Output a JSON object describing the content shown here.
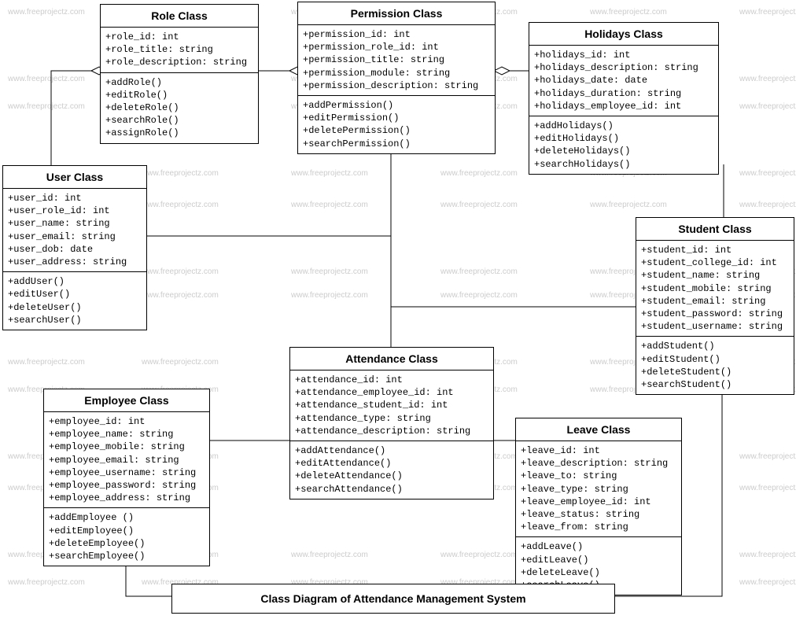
{
  "diagram_title": "Class Diagram of Attendance Management System",
  "watermark_text": "www.freeprojectz.com",
  "classes": {
    "role": {
      "title": "Role Class",
      "attrs": [
        "+role_id: int",
        "+role_title: string",
        "+role_description: string"
      ],
      "methods": [
        "+addRole()",
        "+editRole()",
        "+deleteRole()",
        "+searchRole()",
        "+assignRole()"
      ]
    },
    "permission": {
      "title": "Permission Class",
      "attrs": [
        "+permission_id: int",
        "+permission_role_id: int",
        "+permission_title: string",
        "+permission_module: string",
        "+permission_description: string"
      ],
      "methods": [
        "+addPermission()",
        "+editPermission()",
        "+deletePermission()",
        "+searchPermission()"
      ]
    },
    "holidays": {
      "title": "Holidays Class",
      "attrs": [
        "+holidays_id: int",
        "+holidays_description: string",
        "+holidays_date: date",
        "+holidays_duration: string",
        "+holidays_employee_id: int"
      ],
      "methods": [
        "+addHolidays()",
        "+editHolidays()",
        "+deleteHolidays()",
        "+searchHolidays()"
      ]
    },
    "user": {
      "title": "User Class",
      "attrs": [
        "+user_id: int",
        "+user_role_id: int",
        "+user_name: string",
        "+user_email: string",
        "+user_dob: date",
        "+user_address: string"
      ],
      "methods": [
        "+addUser()",
        "+editUser()",
        "+deleteUser()",
        "+searchUser()"
      ]
    },
    "student": {
      "title": "Student Class",
      "attrs": [
        "+student_id: int",
        "+student_college_id: int",
        "+student_name: string",
        "+student_mobile: string",
        "+student_email: string",
        "+student_password: string",
        "+student_username: string"
      ],
      "methods": [
        "+addStudent()",
        "+editStudent()",
        "+deleteStudent()",
        "+searchStudent()"
      ]
    },
    "attendance": {
      "title": "Attendance Class",
      "attrs": [
        "+attendance_id: int",
        "+attendance_employee_id: int",
        "+attendance_student_id: int",
        "+attendance_type: string",
        "+attendance_description: string"
      ],
      "methods": [
        "+addAttendance()",
        "+editAttendance()",
        "+deleteAttendance()",
        "+searchAttendance()"
      ]
    },
    "employee": {
      "title": "Employee Class",
      "attrs": [
        "+employee_id: int",
        "+employee_name: string",
        "+employee_mobile: string",
        "+employee_email: string",
        "+employee_username: string",
        "+employee_password: string",
        "+employee_address: string"
      ],
      "methods": [
        "+addEmployee ()",
        "+editEmployee()",
        "+deleteEmployee()",
        "+searchEmployee()"
      ]
    },
    "leave": {
      "title": "Leave Class",
      "attrs": [
        "+leave_id: int",
        "+leave_description: string",
        "+leave_to: string",
        "+leave_type: string",
        "+leave_employee_id: int",
        "+leave_status: string",
        "+leave_from: string"
      ],
      "methods": [
        "+addLeave()",
        "+editLeave()",
        "+deleteLeave()",
        "+searchLeave()"
      ]
    }
  }
}
